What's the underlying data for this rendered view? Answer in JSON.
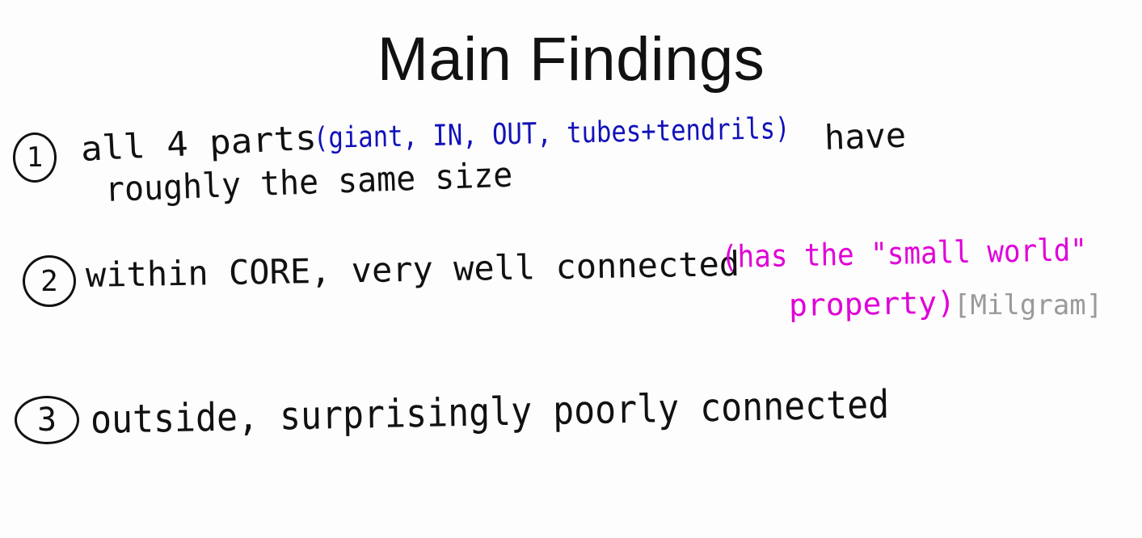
{
  "title": "Main Findings",
  "findings": [
    {
      "number": "1",
      "line1_black": "all 4 parts",
      "line1_blue": "(giant, IN, OUT, tubes+tendrils)",
      "line1_black_end": "have",
      "line2_black": "roughly the same size"
    },
    {
      "number": "2",
      "line1_black": "within CORE, very well connected",
      "line1_pink": "(has the \"small world\"",
      "line2_pink": "property)",
      "line2_gray": "[Milgram]"
    },
    {
      "number": "3",
      "line1_black": "outside, surprisingly poorly connected"
    }
  ],
  "colors": {
    "black_ink": "#111111",
    "blue_ink": "#1111b8",
    "pink_ink": "#e000d8",
    "gray_ink": "#9a9a9a"
  }
}
